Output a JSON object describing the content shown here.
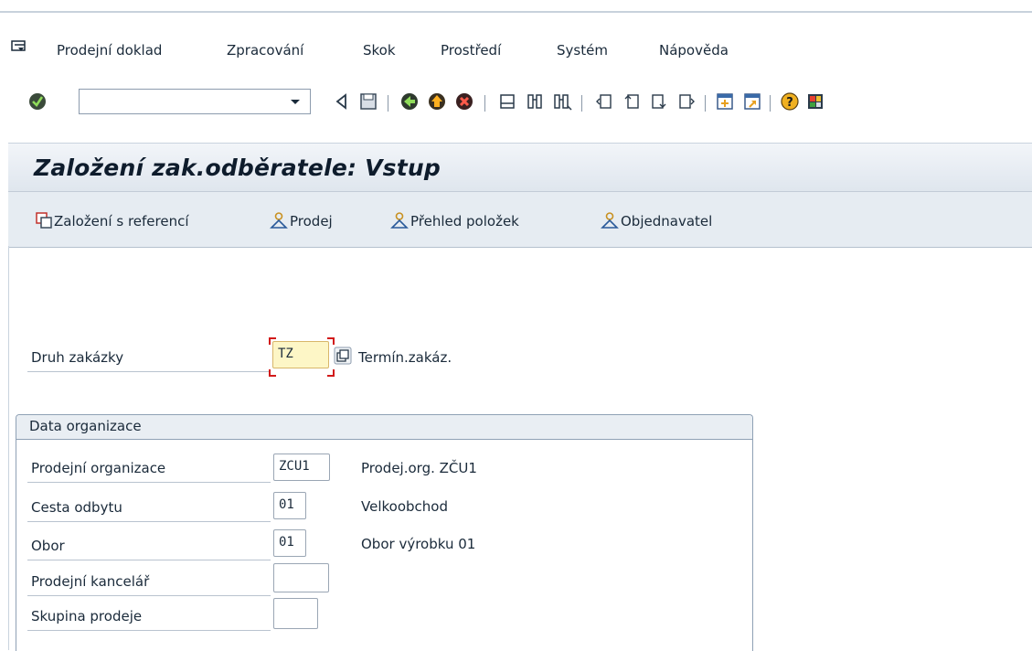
{
  "menu": {
    "items": [
      "Prodejní doklad",
      "Zpracování",
      "Skok",
      "Prostředí",
      "Systém",
      "Nápověda"
    ]
  },
  "toolbar": {
    "command_value": "",
    "icons": [
      "enter-icon",
      "back-icon",
      "save-icon",
      "back-green-icon",
      "exit-icon",
      "cancel-icon",
      "print-icon",
      "find-icon",
      "find-next-icon",
      "first-page-icon",
      "prev-page-icon",
      "next-page-icon",
      "last-page-icon",
      "create-session-icon",
      "shortcut-icon",
      "help-icon",
      "customize-layout-icon"
    ]
  },
  "screen": {
    "title": "Založení zak.odběratele: Vstup",
    "app_buttons": [
      "Založení s referencí",
      "Prodej",
      "Přehled položek",
      "Objednavatel"
    ]
  },
  "order": {
    "label": "Druh zakázky",
    "value": "TZ",
    "description": "Termín.zakáz."
  },
  "org_group": {
    "title": "Data organizace",
    "rows": [
      {
        "label": "Prodejní organizace",
        "value": "ZCU1",
        "description": "Prodej.org. ZČU1"
      },
      {
        "label": "Cesta odbytu",
        "value": "01",
        "description": "Velkoobchod"
      },
      {
        "label": "Obor",
        "value": "01",
        "description": "Obor výrobku 01"
      },
      {
        "label": "Prodejní kancelář",
        "value": "",
        "description": ""
      },
      {
        "label": "Skupina prodeje",
        "value": "",
        "description": ""
      }
    ]
  },
  "colors": {
    "title_bg": "#dfe6ee",
    "appbar_bg": "#e6ecf2",
    "required_bg": "#fdf6c6",
    "required_corner": "#d21a1a"
  }
}
